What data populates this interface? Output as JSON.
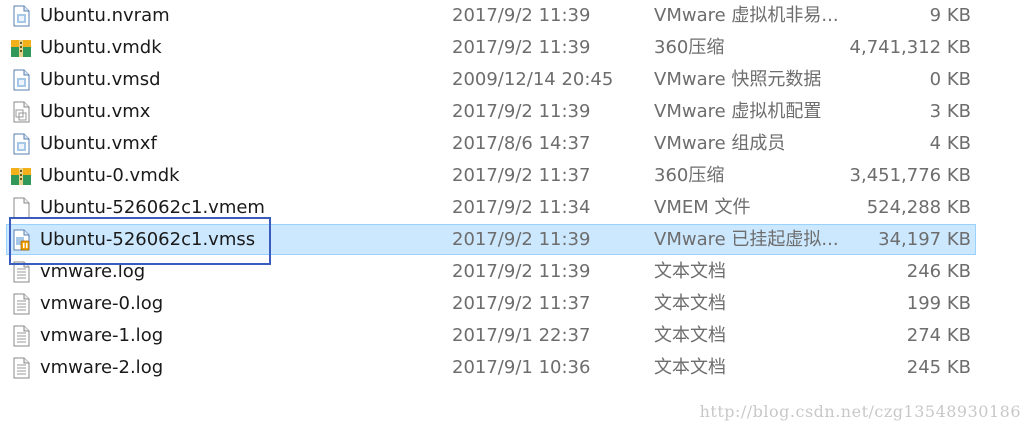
{
  "files": [
    {
      "name": "Ubuntu.nvram",
      "date": "2017/9/2 11:39",
      "type": "VMware 虚拟机非易...",
      "size": "9 KB",
      "icon": "vmware-doc-icon"
    },
    {
      "name": "Ubuntu.vmdk",
      "date": "2017/9/2 11:39",
      "type": "360压缩",
      "size": "4,741,312 KB",
      "icon": "archive-icon"
    },
    {
      "name": "Ubuntu.vmsd",
      "date": "2009/12/14 20:45",
      "type": "VMware 快照元数据",
      "size": "0 KB",
      "icon": "vmware-doc-icon"
    },
    {
      "name": "Ubuntu.vmx",
      "date": "2017/9/2 11:39",
      "type": "VMware 虚拟机配置",
      "size": "3 KB",
      "icon": "vm-config-icon"
    },
    {
      "name": "Ubuntu.vmxf",
      "date": "2017/8/6 14:37",
      "type": "VMware 组成员",
      "size": "4 KB",
      "icon": "vmware-doc-icon"
    },
    {
      "name": "Ubuntu-0.vmdk",
      "date": "2017/9/2 11:37",
      "type": "360压缩",
      "size": "3,451,776 KB",
      "icon": "archive-icon"
    },
    {
      "name": "Ubuntu-526062c1.vmem",
      "date": "2017/9/2 11:34",
      "type": "VMEM 文件",
      "size": "524,288 KB",
      "icon": "blank-file-icon"
    },
    {
      "name": "Ubuntu-526062c1.vmss",
      "date": "2017/9/2 11:39",
      "type": "VMware 已挂起虚拟...",
      "size": "34,197 KB",
      "icon": "vm-suspended-icon",
      "selected": true
    },
    {
      "name": "vmware.log",
      "date": "2017/9/2 11:39",
      "type": "文本文档",
      "size": "246 KB",
      "icon": "text-file-icon"
    },
    {
      "name": "vmware-0.log",
      "date": "2017/9/2 11:37",
      "type": "文本文档",
      "size": "199 KB",
      "icon": "text-file-icon"
    },
    {
      "name": "vmware-1.log",
      "date": "2017/9/1 22:37",
      "type": "文本文档",
      "size": "274 KB",
      "icon": "text-file-icon"
    },
    {
      "name": "vmware-2.log",
      "date": "2017/9/1 10:36",
      "type": "文本文档",
      "size": "245 KB",
      "icon": "text-file-icon"
    }
  ],
  "watermark": "http://blog.csdn.net/czg13548930186",
  "colors": {
    "selection": "#cce8ff",
    "selection_border": "#99d1ff",
    "highlight_box": "#3a5bbf"
  }
}
